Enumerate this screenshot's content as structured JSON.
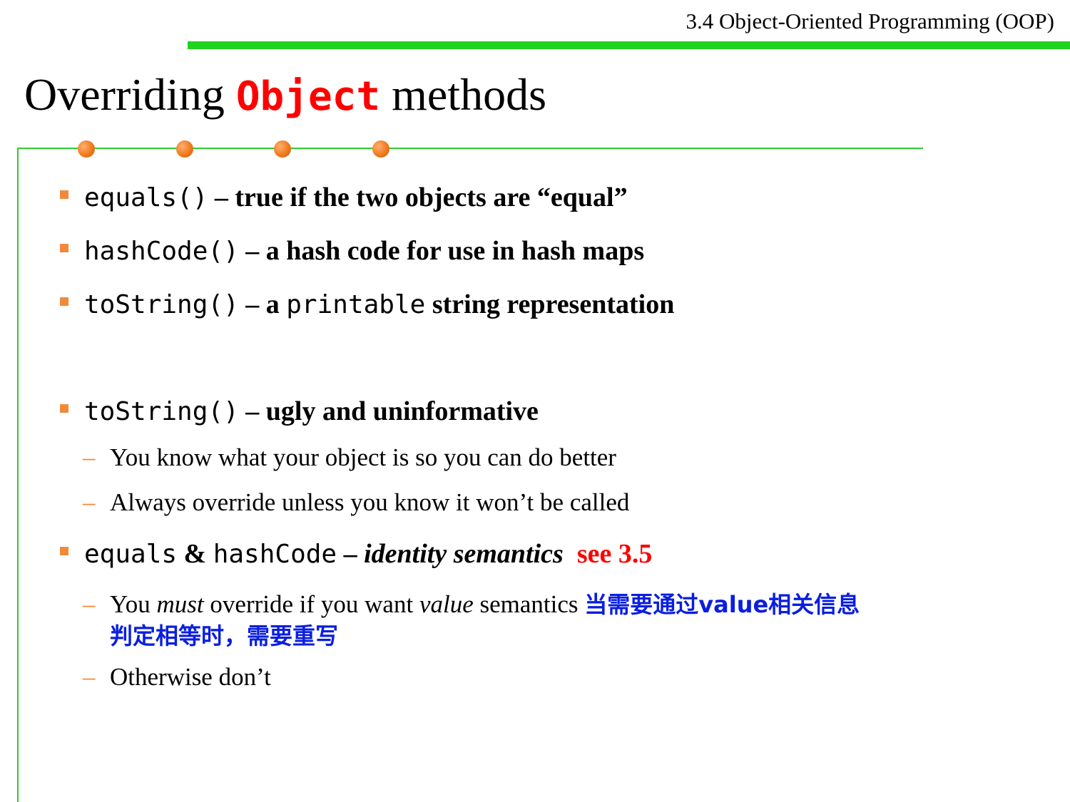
{
  "header": {
    "section": "3.4 Object-Oriented Programming (OOP)"
  },
  "title": {
    "prefix": "Overriding",
    "code": "Object",
    "suffix": "methods"
  },
  "bullets": [
    {
      "code": "equals()",
      "text": " – true if the two objects are “equal”"
    },
    {
      "code": "hashCode()",
      "text": " – a hash code for use in hash maps"
    },
    {
      "code": "toString()",
      "text_a": " – a ",
      "code2": "printable",
      "text_b": " string representation"
    },
    {
      "code": "toString()",
      "text": " – ugly and uninformative"
    },
    {
      "code": "equals",
      "amp": " & ",
      "code2": "hashCode",
      "text": " – ",
      "italic": "identity semantics",
      "red": "see 3.5"
    }
  ],
  "subs": {
    "tostring_1": "You know what your object is so you can do better",
    "tostring_2": "Always override unless you know it won’t be called",
    "value_a": "You ",
    "value_must": "must",
    "value_b": " override if you want ",
    "value_value": "value",
    "value_c": " semantics ",
    "value_cn_1": "当需要通过value相关信息",
    "value_cn_2": "判定相等时，需要重写",
    "otherwise": "Otherwise don’t"
  },
  "colors": {
    "green": "#1fd31f",
    "orange": "#f08a3a",
    "red": "#ff0000",
    "blue": "#0a1ee0"
  }
}
